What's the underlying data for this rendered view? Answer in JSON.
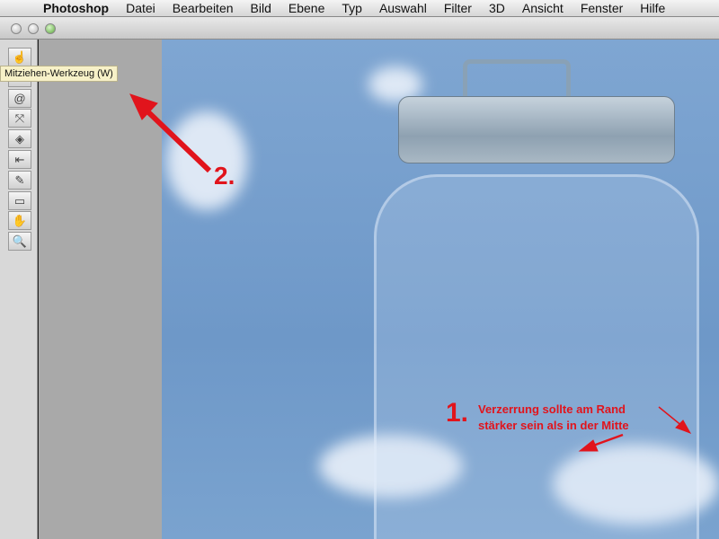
{
  "menubar": {
    "app": "Photoshop",
    "items": [
      "Datei",
      "Bearbeiten",
      "Bild",
      "Ebene",
      "Typ",
      "Auswahl",
      "Filter",
      "3D",
      "Ansicht",
      "Fenster",
      "Hilfe"
    ]
  },
  "tools": [
    {
      "icon": "forward-warp-icon",
      "glyph": "☝"
    },
    {
      "icon": "reconstruct-icon",
      "glyph": "⟲"
    },
    {
      "icon": "twirl-icon",
      "glyph": "@"
    },
    {
      "icon": "pucker-icon",
      "glyph": "⤧"
    },
    {
      "icon": "bloat-icon",
      "glyph": "◈"
    },
    {
      "icon": "push-left-icon",
      "glyph": "⇤"
    },
    {
      "icon": "freeze-mask-icon",
      "glyph": "✎"
    },
    {
      "icon": "thaw-mask-icon",
      "glyph": "▭"
    },
    {
      "icon": "hand-icon",
      "glyph": "✋"
    },
    {
      "icon": "zoom-icon",
      "glyph": "🔍"
    }
  ],
  "tooltip": "Mitziehen-Werkzeug (W)",
  "annotations": {
    "step2": "2.",
    "step1": "1.",
    "note_line1": "Verzerrung  sollte am Rand",
    "note_line2": "stärker sein als in der Mitte",
    "color": "#e1141c"
  }
}
